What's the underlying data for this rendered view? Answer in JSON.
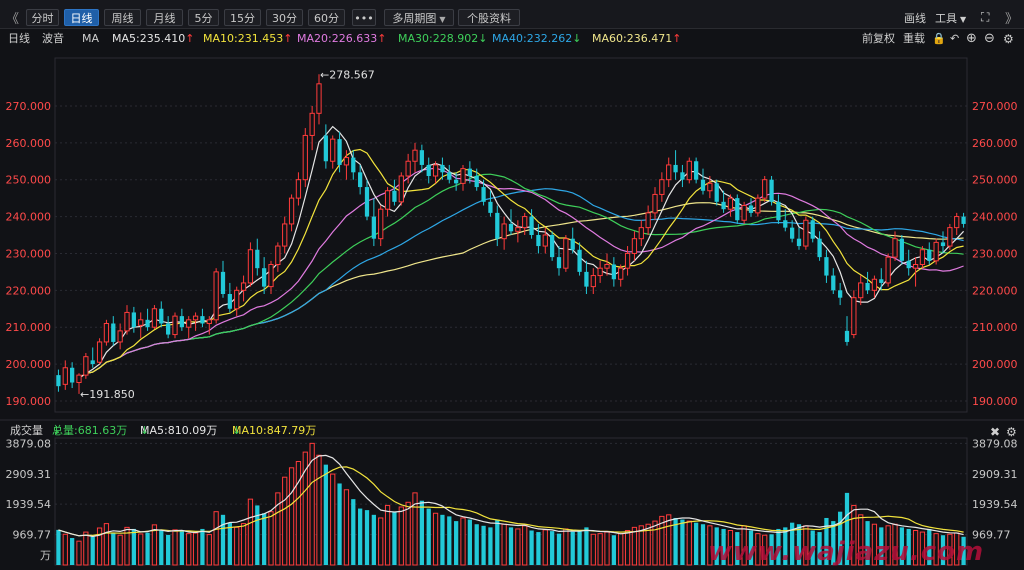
{
  "toolbar": {
    "prev_label": "《",
    "next_label": "》",
    "tabs": [
      {
        "label": "分时",
        "active": false
      },
      {
        "label": "日线",
        "active": true
      },
      {
        "label": "周线",
        "active": false
      },
      {
        "label": "月线",
        "active": false
      },
      {
        "label": "5分",
        "active": false
      },
      {
        "label": "15分",
        "active": false
      },
      {
        "label": "30分",
        "active": false
      },
      {
        "label": "60分",
        "active": false
      }
    ],
    "more_label": "•••",
    "multi_period_label": "多周期图",
    "stock_info_label": "个股资料",
    "draw_label": "画线",
    "tools_label": "工具"
  },
  "legend": {
    "period": "日线",
    "wave": "波音",
    "ma": "MA",
    "items": [
      {
        "text": "MA5:235.410",
        "arrow": "↑",
        "color": "#e6e6e6",
        "arrow_color": "#ff3b3b"
      },
      {
        "text": "MA10:231.453",
        "arrow": "↑",
        "color": "#f2e33c",
        "arrow_color": "#ff3b3b"
      },
      {
        "text": "MA20:226.633",
        "arrow": "↑",
        "color": "#e07be0",
        "arrow_color": "#ff3b3b"
      },
      {
        "text": "MA30:228.902",
        "arrow": "↓",
        "color": "#3ecf5a",
        "arrow_color": "#3ecf5a"
      },
      {
        "text": "MA40:232.262",
        "arrow": "↓",
        "color": "#2ea7e6",
        "arrow_color": "#3ecf5a"
      },
      {
        "text": "MA60:236.471",
        "arrow": "↑",
        "color": "#f0e68c",
        "arrow_color": "#ff3b3b"
      }
    ],
    "adjust_label": "前复权",
    "restore_label": "重载"
  },
  "volume_legend": {
    "title": "成交量",
    "total": "总量:681.63万",
    "total_arrow": "↓",
    "ma5": "MA5:810.09万",
    "ma5_arrow": "↓",
    "ma10": "MA10:847.79万",
    "ma10_arrow": "↓"
  },
  "price_axis_labels": [
    "270.000",
    "260.000",
    "250.000",
    "240.000",
    "230.000",
    "220.000",
    "210.000",
    "200.000",
    "190.000"
  ],
  "volume_axis_labels": [
    "3879.08",
    "2909.31",
    "1939.54",
    "969.77",
    "万"
  ],
  "annotations": {
    "high": "←278.567",
    "low": "←191.850"
  },
  "watermark": "www.wajiazu.com",
  "colors": {
    "up": "#ff3b3b",
    "down": "#22c9d8",
    "bg": "#111216",
    "grid": "#2a2b33",
    "axis_text": "#ff4a4a"
  },
  "chart_data": {
    "type": "candlestick",
    "title": "",
    "ylim": [
      187,
      283
    ],
    "high_value": 278.567,
    "low_value": 191.85,
    "candles": [
      {
        "o": 197.0,
        "h": 198.5,
        "l": 192.5,
        "c": 194.0
      },
      {
        "o": 194.5,
        "h": 201.0,
        "l": 193.0,
        "c": 199.0
      },
      {
        "o": 199.0,
        "h": 200.5,
        "l": 193.5,
        "c": 195.0
      },
      {
        "o": 195.0,
        "h": 197.5,
        "l": 191.9,
        "c": 197.0
      },
      {
        "o": 197.0,
        "h": 203.0,
        "l": 196.0,
        "c": 202.0
      },
      {
        "o": 201.0,
        "h": 204.5,
        "l": 199.0,
        "c": 200.0
      },
      {
        "o": 200.5,
        "h": 207.0,
        "l": 200.0,
        "c": 206.0
      },
      {
        "o": 206.0,
        "h": 212.0,
        "l": 205.0,
        "c": 211.0
      },
      {
        "o": 211.0,
        "h": 213.0,
        "l": 205.0,
        "c": 206.0
      },
      {
        "o": 206.0,
        "h": 211.0,
        "l": 204.0,
        "c": 209.0
      },
      {
        "o": 209.0,
        "h": 216.0,
        "l": 208.0,
        "c": 214.0
      },
      {
        "o": 214.0,
        "h": 215.5,
        "l": 208.5,
        "c": 210.0
      },
      {
        "o": 210.5,
        "h": 214.0,
        "l": 207.0,
        "c": 212.0
      },
      {
        "o": 212.0,
        "h": 215.0,
        "l": 209.0,
        "c": 210.0
      },
      {
        "o": 210.0,
        "h": 216.0,
        "l": 209.5,
        "c": 215.0
      },
      {
        "o": 215.0,
        "h": 217.0,
        "l": 210.0,
        "c": 211.0
      },
      {
        "o": 211.0,
        "h": 213.0,
        "l": 207.0,
        "c": 208.0
      },
      {
        "o": 208.0,
        "h": 214.0,
        "l": 207.0,
        "c": 213.0
      },
      {
        "o": 213.0,
        "h": 215.0,
        "l": 209.0,
        "c": 210.0
      },
      {
        "o": 210.0,
        "h": 213.0,
        "l": 207.0,
        "c": 212.0
      },
      {
        "o": 212.0,
        "h": 214.0,
        "l": 209.0,
        "c": 213.0
      },
      {
        "o": 213.0,
        "h": 215.0,
        "l": 210.0,
        "c": 211.0
      },
      {
        "o": 211.0,
        "h": 213.0,
        "l": 208.0,
        "c": 212.0
      },
      {
        "o": 212.0,
        "h": 226.0,
        "l": 211.0,
        "c": 225.0
      },
      {
        "o": 225.0,
        "h": 228.0,
        "l": 218.0,
        "c": 219.0
      },
      {
        "o": 219.0,
        "h": 222.0,
        "l": 214.0,
        "c": 215.0
      },
      {
        "o": 215.0,
        "h": 221.0,
        "l": 213.0,
        "c": 220.0
      },
      {
        "o": 220.0,
        "h": 224.0,
        "l": 217.0,
        "c": 222.0
      },
      {
        "o": 222.0,
        "h": 233.0,
        "l": 221.0,
        "c": 231.0
      },
      {
        "o": 231.0,
        "h": 234.0,
        "l": 224.0,
        "c": 226.0
      },
      {
        "o": 226.0,
        "h": 229.0,
        "l": 219.0,
        "c": 221.0
      },
      {
        "o": 221.0,
        "h": 228.0,
        "l": 219.0,
        "c": 227.0
      },
      {
        "o": 227.0,
        "h": 233.0,
        "l": 225.0,
        "c": 232.0
      },
      {
        "o": 232.0,
        "h": 240.0,
        "l": 230.0,
        "c": 238.0
      },
      {
        "o": 238.0,
        "h": 246.0,
        "l": 236.0,
        "c": 245.0
      },
      {
        "o": 245.0,
        "h": 252.0,
        "l": 243.0,
        "c": 250.0
      },
      {
        "o": 250.0,
        "h": 264.0,
        "l": 248.0,
        "c": 262.0
      },
      {
        "o": 262.0,
        "h": 270.0,
        "l": 258.0,
        "c": 268.0
      },
      {
        "o": 268.0,
        "h": 278.6,
        "l": 265.0,
        "c": 276.0
      },
      {
        "o": 262.0,
        "h": 265.0,
        "l": 253.0,
        "c": 255.0
      },
      {
        "o": 255.0,
        "h": 262.0,
        "l": 253.0,
        "c": 261.0
      },
      {
        "o": 261.0,
        "h": 263.0,
        "l": 252.0,
        "c": 254.0
      },
      {
        "o": 254.0,
        "h": 258.0,
        "l": 250.0,
        "c": 256.0
      },
      {
        "o": 256.0,
        "h": 258.0,
        "l": 250.0,
        "c": 252.0
      },
      {
        "o": 252.0,
        "h": 254.0,
        "l": 246.0,
        "c": 248.0
      },
      {
        "o": 248.0,
        "h": 250.0,
        "l": 239.0,
        "c": 240.0
      },
      {
        "o": 240.0,
        "h": 245.0,
        "l": 232.0,
        "c": 234.0
      },
      {
        "o": 234.0,
        "h": 243.0,
        "l": 232.0,
        "c": 242.0
      },
      {
        "o": 242.0,
        "h": 248.0,
        "l": 240.0,
        "c": 247.0
      },
      {
        "o": 247.0,
        "h": 250.0,
        "l": 243.0,
        "c": 244.0
      },
      {
        "o": 244.0,
        "h": 252.0,
        "l": 243.0,
        "c": 251.0
      },
      {
        "o": 251.0,
        "h": 257.0,
        "l": 249.0,
        "c": 255.0
      },
      {
        "o": 255.0,
        "h": 260.0,
        "l": 252.0,
        "c": 258.0
      },
      {
        "o": 258.0,
        "h": 259.5,
        "l": 252.0,
        "c": 254.0
      },
      {
        "o": 254.0,
        "h": 256.0,
        "l": 249.0,
        "c": 251.0
      },
      {
        "o": 251.0,
        "h": 255.0,
        "l": 249.0,
        "c": 254.0
      },
      {
        "o": 254.0,
        "h": 256.0,
        "l": 250.0,
        "c": 252.0
      },
      {
        "o": 252.0,
        "h": 254.0,
        "l": 249.0,
        "c": 250.0
      },
      {
        "o": 250.0,
        "h": 252.0,
        "l": 247.0,
        "c": 249.0
      },
      {
        "o": 249.0,
        "h": 254.0,
        "l": 247.0,
        "c": 253.0
      },
      {
        "o": 253.0,
        "h": 255.0,
        "l": 249.0,
        "c": 251.0
      },
      {
        "o": 251.0,
        "h": 253.0,
        "l": 247.0,
        "c": 248.0
      },
      {
        "o": 248.0,
        "h": 250.0,
        "l": 243.0,
        "c": 244.0
      },
      {
        "o": 244.0,
        "h": 247.0,
        "l": 240.0,
        "c": 241.0
      },
      {
        "o": 241.0,
        "h": 243.0,
        "l": 232.0,
        "c": 234.0
      },
      {
        "o": 234.0,
        "h": 240.0,
        "l": 231.0,
        "c": 238.0
      },
      {
        "o": 238.0,
        "h": 242.0,
        "l": 235.0,
        "c": 236.0
      },
      {
        "o": 236.0,
        "h": 239.0,
        "l": 233.0,
        "c": 237.0
      },
      {
        "o": 237.0,
        "h": 241.0,
        "l": 235.0,
        "c": 240.0
      },
      {
        "o": 240.0,
        "h": 242.0,
        "l": 234.0,
        "c": 235.0
      },
      {
        "o": 235.0,
        "h": 238.0,
        "l": 230.0,
        "c": 232.0
      },
      {
        "o": 232.0,
        "h": 237.0,
        "l": 230.0,
        "c": 235.0
      },
      {
        "o": 235.0,
        "h": 236.0,
        "l": 228.0,
        "c": 229.0
      },
      {
        "o": 229.0,
        "h": 232.0,
        "l": 224.0,
        "c": 226.0
      },
      {
        "o": 226.0,
        "h": 235.0,
        "l": 225.0,
        "c": 234.0
      },
      {
        "o": 234.0,
        "h": 237.0,
        "l": 230.0,
        "c": 231.0
      },
      {
        "o": 231.0,
        "h": 233.0,
        "l": 224.0,
        "c": 225.0
      },
      {
        "o": 225.0,
        "h": 228.0,
        "l": 219.0,
        "c": 221.0
      },
      {
        "o": 221.0,
        "h": 226.0,
        "l": 219.0,
        "c": 224.0
      },
      {
        "o": 224.0,
        "h": 228.0,
        "l": 222.0,
        "c": 226.0
      },
      {
        "o": 226.0,
        "h": 230.0,
        "l": 224.0,
        "c": 227.0
      },
      {
        "o": 227.0,
        "h": 229.0,
        "l": 221.0,
        "c": 223.0
      },
      {
        "o": 223.0,
        "h": 227.0,
        "l": 221.0,
        "c": 226.0
      },
      {
        "o": 226.0,
        "h": 232.0,
        "l": 224.0,
        "c": 230.0
      },
      {
        "o": 230.0,
        "h": 236.0,
        "l": 228.0,
        "c": 234.0
      },
      {
        "o": 234.0,
        "h": 239.0,
        "l": 232.0,
        "c": 237.0
      },
      {
        "o": 237.0,
        "h": 243.0,
        "l": 235.0,
        "c": 241.0
      },
      {
        "o": 241.0,
        "h": 248.0,
        "l": 239.0,
        "c": 246.0
      },
      {
        "o": 246.0,
        "h": 252.0,
        "l": 244.0,
        "c": 250.0
      },
      {
        "o": 250.0,
        "h": 256.0,
        "l": 248.0,
        "c": 254.0
      },
      {
        "o": 254.0,
        "h": 258.0,
        "l": 250.0,
        "c": 252.0
      },
      {
        "o": 252.0,
        "h": 254.0,
        "l": 248.0,
        "c": 250.0
      },
      {
        "o": 250.0,
        "h": 256.0,
        "l": 249.0,
        "c": 255.0
      },
      {
        "o": 255.0,
        "h": 256.0,
        "l": 249.0,
        "c": 250.0
      },
      {
        "o": 250.0,
        "h": 253.0,
        "l": 246.0,
        "c": 247.0
      },
      {
        "o": 247.0,
        "h": 251.0,
        "l": 245.0,
        "c": 249.0
      },
      {
        "o": 249.0,
        "h": 250.0,
        "l": 243.0,
        "c": 244.0
      },
      {
        "o": 244.0,
        "h": 247.0,
        "l": 241.0,
        "c": 242.0
      },
      {
        "o": 242.0,
        "h": 246.0,
        "l": 240.0,
        "c": 245.0
      },
      {
        "o": 245.0,
        "h": 246.0,
        "l": 238.0,
        "c": 239.0
      },
      {
        "o": 239.0,
        "h": 244.0,
        "l": 238.0,
        "c": 243.0
      },
      {
        "o": 243.0,
        "h": 245.0,
        "l": 240.0,
        "c": 241.0
      },
      {
        "o": 241.0,
        "h": 246.0,
        "l": 240.0,
        "c": 245.0
      },
      {
        "o": 245.0,
        "h": 251.0,
        "l": 244.0,
        "c": 250.0
      },
      {
        "o": 250.0,
        "h": 251.0,
        "l": 243.0,
        "c": 244.0
      },
      {
        "o": 244.0,
        "h": 246.0,
        "l": 238.0,
        "c": 239.0
      },
      {
        "o": 239.0,
        "h": 242.0,
        "l": 236.0,
        "c": 237.0
      },
      {
        "o": 237.0,
        "h": 239.0,
        "l": 233.0,
        "c": 234.0
      },
      {
        "o": 234.0,
        "h": 237.0,
        "l": 231.0,
        "c": 232.0
      },
      {
        "o": 232.0,
        "h": 240.0,
        "l": 231.0,
        "c": 239.0
      },
      {
        "o": 239.0,
        "h": 240.0,
        "l": 233.0,
        "c": 234.0
      },
      {
        "o": 234.0,
        "h": 236.0,
        "l": 228.0,
        "c": 229.0
      },
      {
        "o": 229.0,
        "h": 231.0,
        "l": 222.0,
        "c": 224.0
      },
      {
        "o": 224.0,
        "h": 226.0,
        "l": 219.0,
        "c": 220.0
      },
      {
        "o": 220.0,
        "h": 222.0,
        "l": 216.0,
        "c": 218.0
      },
      {
        "o": 209.0,
        "h": 213.0,
        "l": 205.0,
        "c": 206.0
      },
      {
        "o": 208.0,
        "h": 220.0,
        "l": 207.0,
        "c": 218.0
      },
      {
        "o": 218.0,
        "h": 224.0,
        "l": 216.0,
        "c": 222.0
      },
      {
        "o": 222.0,
        "h": 225.0,
        "l": 219.0,
        "c": 220.0
      },
      {
        "o": 220.0,
        "h": 224.0,
        "l": 218.0,
        "c": 223.0
      },
      {
        "o": 223.0,
        "h": 226.0,
        "l": 220.0,
        "c": 222.0
      },
      {
        "o": 222.0,
        "h": 230.0,
        "l": 221.0,
        "c": 229.0
      },
      {
        "o": 229.0,
        "h": 236.0,
        "l": 228.0,
        "c": 234.0
      },
      {
        "o": 234.0,
        "h": 235.0,
        "l": 227.0,
        "c": 228.0
      },
      {
        "o": 228.0,
        "h": 231.0,
        "l": 224.0,
        "c": 226.0
      },
      {
        "o": 226.0,
        "h": 229.0,
        "l": 221.0,
        "c": 227.0
      },
      {
        "o": 227.0,
        "h": 232.0,
        "l": 226.0,
        "c": 231.0
      },
      {
        "o": 231.0,
        "h": 233.0,
        "l": 227.0,
        "c": 228.0
      },
      {
        "o": 228.0,
        "h": 234.0,
        "l": 227.0,
        "c": 233.0
      },
      {
        "o": 233.0,
        "h": 236.0,
        "l": 230.0,
        "c": 232.0
      },
      {
        "o": 232.0,
        "h": 238.0,
        "l": 231.0,
        "c": 237.0
      },
      {
        "o": 237.0,
        "h": 241.0,
        "l": 235.0,
        "c": 240.0
      },
      {
        "o": 240.0,
        "h": 241.0,
        "l": 237.0,
        "c": 238.0
      }
    ],
    "volume": [
      1120,
      980,
      860,
      760,
      1050,
      900,
      1180,
      1320,
      1010,
      950,
      1200,
      1150,
      990,
      1030,
      1280,
      1100,
      960,
      1120,
      1080,
      1000,
      1020,
      1150,
      970,
      1700,
      1600,
      1350,
      1200,
      1320,
      2100,
      1900,
      1650,
      1700,
      2300,
      2800,
      3100,
      3300,
      3600,
      3879,
      3500,
      3200,
      2900,
      2600,
      2400,
      2100,
      1800,
      1750,
      1600,
      1500,
      1900,
      1700,
      1850,
      2000,
      2300,
      2050,
      1800,
      1650,
      1600,
      1550,
      1400,
      1500,
      1450,
      1300,
      1250,
      1200,
      1450,
      1300,
      1200,
      1150,
      1250,
      1100,
      1050,
      1120,
      1080,
      1000,
      1150,
      1060,
      1100,
      1200,
      980,
      1000,
      1050,
      950,
      1000,
      1100,
      1200,
      1250,
      1300,
      1400,
      1550,
      1600,
      1500,
      1450,
      1400,
      1350,
      1300,
      1250,
      1200,
      1150,
      1100,
      1050,
      1250,
      1100,
      1000,
      950,
      980,
      1150,
      1200,
      1350,
      1300,
      1250,
      1100,
      1050,
      1500,
      1400,
      1700,
      2300,
      1900,
      1600,
      1400,
      1300,
      1200,
      1250,
      1300,
      1200,
      1150,
      1100,
      1050,
      1150,
      1000,
      950,
      980,
      1020,
      900
    ]
  }
}
